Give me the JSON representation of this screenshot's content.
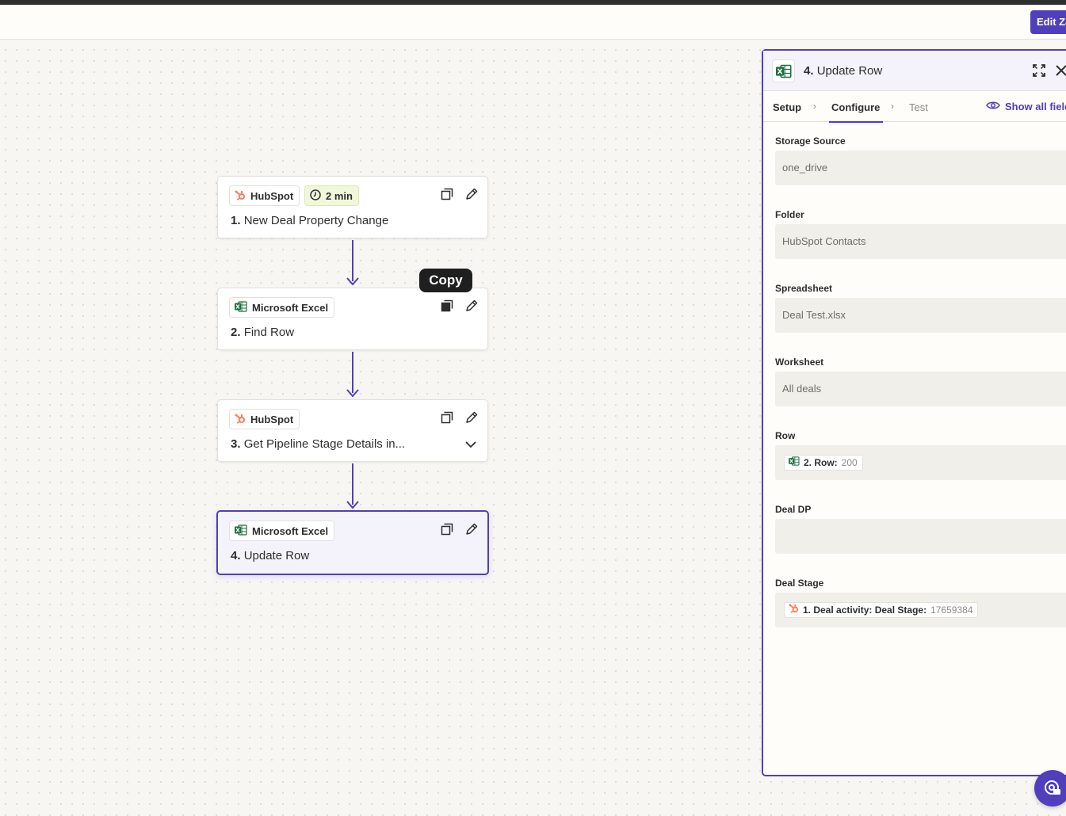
{
  "topbar": {
    "edit_label": "Edit Zap"
  },
  "steps": [
    {
      "app": "HubSpot",
      "badge": "2 min",
      "number": "1.",
      "title": "New Deal Property Change"
    },
    {
      "app": "Microsoft Excel",
      "number": "2.",
      "title": "Find Row"
    },
    {
      "app": "HubSpot",
      "number": "3.",
      "title": "Get Pipeline Stage Details in..."
    },
    {
      "app": "Microsoft Excel",
      "number": "4.",
      "title": "Update Row"
    }
  ],
  "tooltip": {
    "label": "Copy"
  },
  "panel": {
    "number": "4.",
    "title": "Update Row",
    "tabs": {
      "setup": "Setup",
      "configure": "Configure",
      "test": "Test"
    },
    "show_all": "Show all fields",
    "fields": [
      {
        "label": "Storage Source",
        "value": "one_drive"
      },
      {
        "label": "Folder",
        "value": "HubSpot Contacts"
      },
      {
        "label": "Spreadsheet",
        "value": "Deal Test.xlsx"
      },
      {
        "label": "Worksheet",
        "value": "All deals"
      },
      {
        "label": "Row",
        "pill_label": "2. Row:",
        "pill_value": "200"
      },
      {
        "label": "Deal DP",
        "value": ""
      },
      {
        "label": "Deal Stage",
        "pill_label": "1. Deal activity: Deal Stage:",
        "pill_value": "17659384"
      }
    ]
  },
  "icons": {
    "hubspot": "hubspot-icon",
    "excel": "excel-icon",
    "clock": "clock-icon",
    "copy": "copy-icon",
    "edit": "pencil-icon",
    "chevron": "chevron-down-icon",
    "expand": "expand-icon",
    "close": "close-icon",
    "eye": "eye-icon",
    "help": "help-chat-icon"
  },
  "colors": {
    "accent": "#503ebd",
    "hubspot": "#ff7a59",
    "excel": "#1d6f42"
  }
}
